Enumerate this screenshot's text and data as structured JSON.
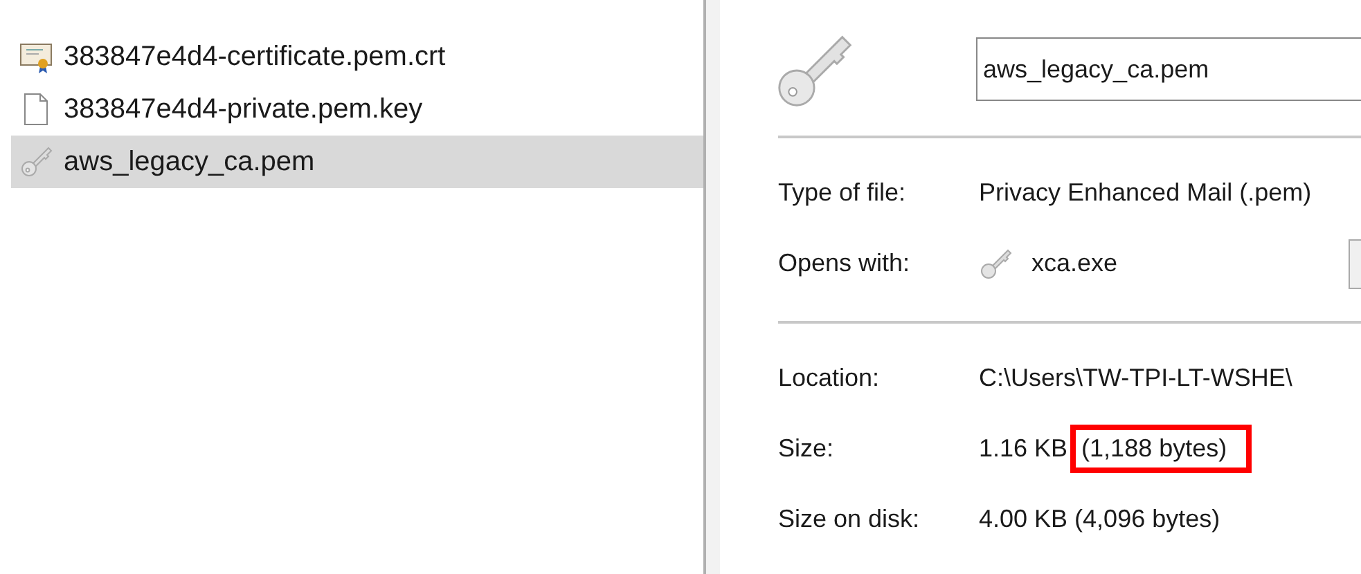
{
  "files": [
    {
      "name": "383847e4d4-certificate.pem.crt",
      "kind": "certificate",
      "selected": false
    },
    {
      "name": "383847e4d4-private.pem.key",
      "kind": "document",
      "selected": false
    },
    {
      "name": "aws_legacy_ca.pem",
      "kind": "key",
      "selected": true
    }
  ],
  "properties": {
    "file_name": "aws_legacy_ca.pem",
    "type_of_file": {
      "label": "Type of file:",
      "value": "Privacy Enhanced Mail (.pem)"
    },
    "opens_with": {
      "label": "Opens with:",
      "value": "xca.exe"
    },
    "location": {
      "label": "Location:",
      "value": "C:\\Users\\TW-TPI-LT-WSHE\\"
    },
    "size": {
      "label": "Size:",
      "parts": [
        {
          "text": "1.16 KB",
          "highlighted": false
        },
        {
          "text": "(1,188 bytes)",
          "highlighted": true
        }
      ]
    },
    "size_on_disk": {
      "label": "Size on disk:",
      "value": "4.00 KB (4,096 bytes)"
    }
  }
}
